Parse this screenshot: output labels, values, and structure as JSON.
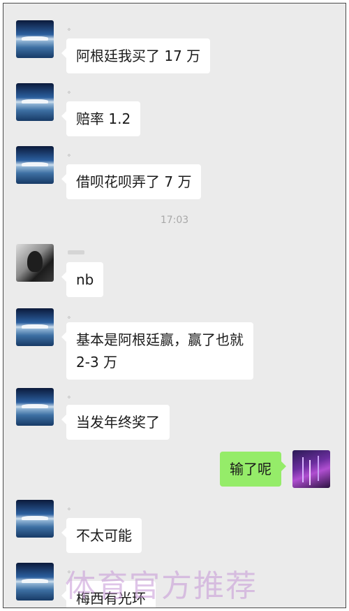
{
  "messages": [
    {
      "text": "阿根廷我买了 17 万"
    },
    {
      "text": "赔率 1.2"
    },
    {
      "text": "借呗花呗弄了 7 万"
    },
    {
      "text": "nb"
    },
    {
      "text": "基本是阿根廷赢，赢了也就\n2-3 万"
    },
    {
      "text": "当发年终奖了"
    },
    {
      "text": "输了呢"
    },
    {
      "text": "不太可能"
    },
    {
      "text": "梅西有光环"
    }
  ],
  "timestamp": "17:03",
  "sender_mark": "。",
  "watermark": "体育官方推荐",
  "colors": {
    "background": "#ebebeb",
    "bubble_in": "#ffffff",
    "bubble_out": "#95ec69"
  }
}
